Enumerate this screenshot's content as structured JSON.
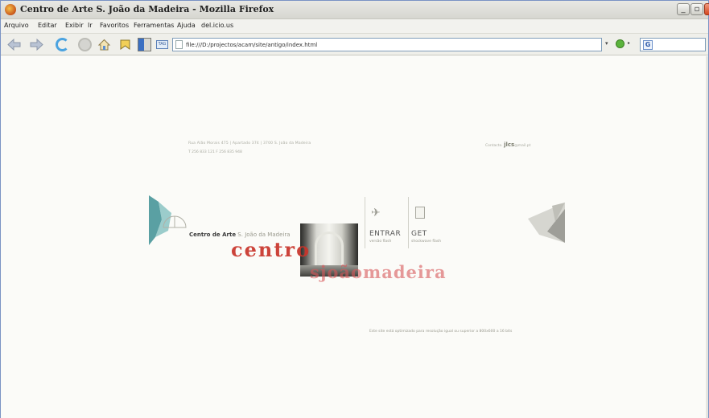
{
  "window": {
    "title": "Centro de Arte S. João da Madeira - Mozilla Firefox",
    "controls": {
      "minimize": "_",
      "maximize": "▫",
      "close": "x"
    }
  },
  "menubar": [
    "Arquivo",
    "Editar",
    "Exibir",
    "Ir",
    "Favoritos",
    "Ferramentas",
    "Ajuda",
    "del.icio.us"
  ],
  "toolbar": {
    "url": "file:///D:/projectos/acam/site/antigo/index.html",
    "dropdown": "▾",
    "go_arrow": "▸"
  },
  "page": {
    "address": "Rua Alão Morais 475  |  Apartado 374  |  3700 S. João da Madeira",
    "phone": "T 256 833 121  F 256 835 948",
    "contact_prefix": "Contacto.",
    "contact_logo": "jlcs",
    "contact_suffix": "@mail.pt",
    "name_bold": "Centro de Arte",
    "name_light": " S. João da Madeira",
    "word_centro": "centro",
    "word_sjoao": "sjoãomadeira",
    "enter_label": "ENTRAR",
    "enter_sub": "versão flash",
    "get_label": "GET",
    "get_sub": "shockwave flash",
    "resolution_note": "Este site está optimizado para resolução igual ou superior a 800x600 a 16 bits"
  }
}
